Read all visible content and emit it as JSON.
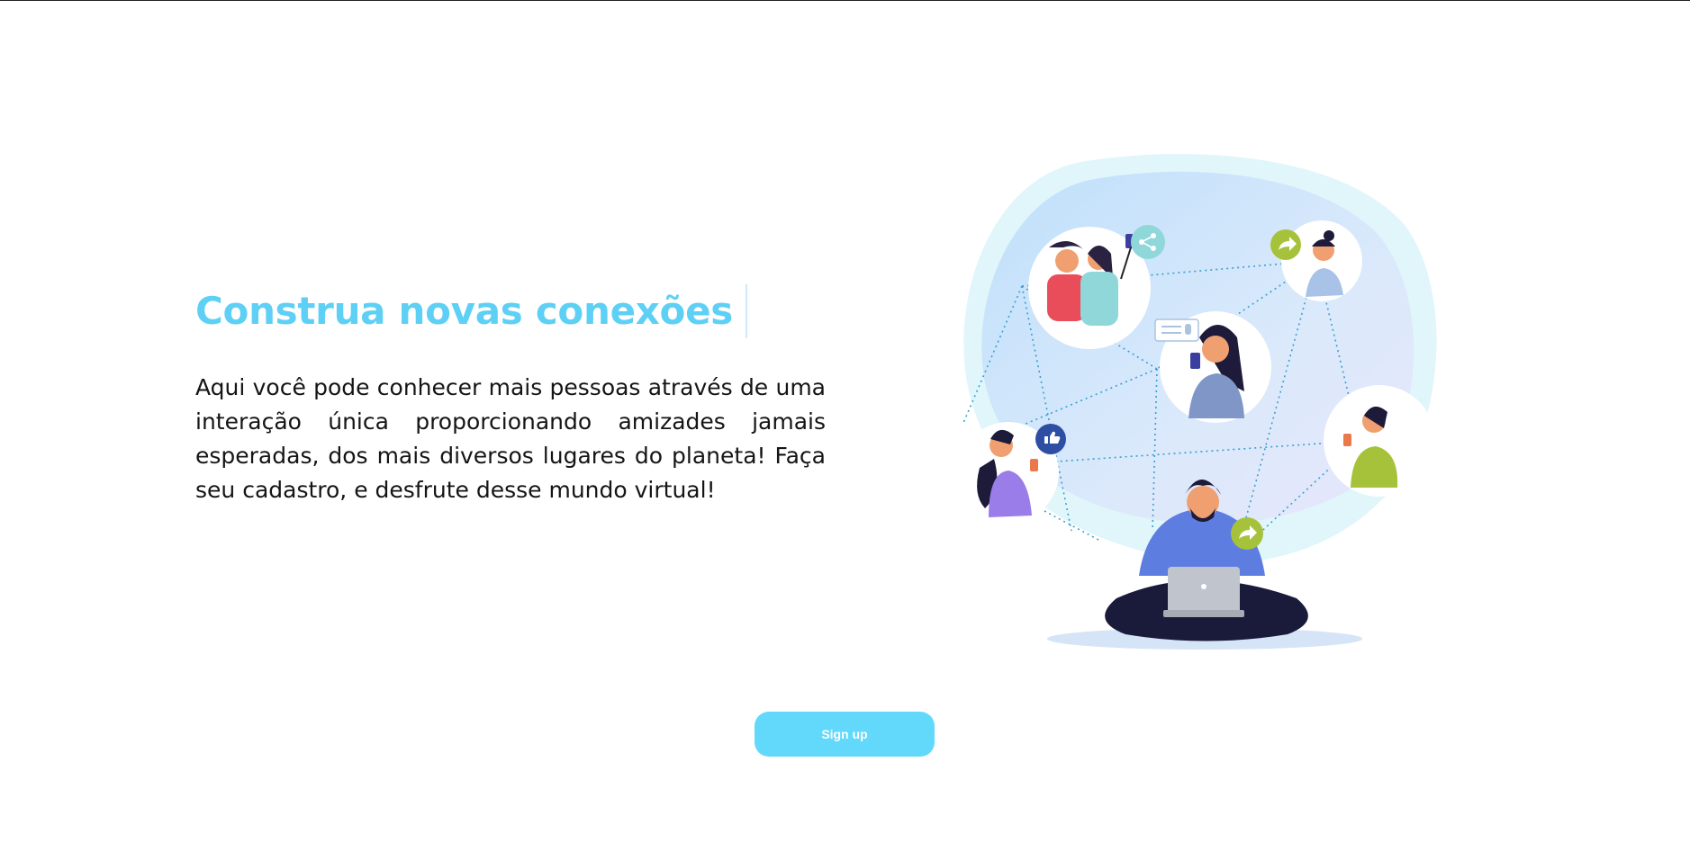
{
  "hero": {
    "title": "Construa novas conexões",
    "description": "Aqui você pode conhecer mais pessoas através de uma interação única proporcionando amizades jamais esperadas, dos mais diversos lugares do planeta! Faça seu cadastro, e desfrute desse mundo virtual!"
  },
  "cta": {
    "signup_label": "Sign up"
  },
  "colors": {
    "accent": "#5ed0f5",
    "button": "#62d9fb",
    "text": "#151515"
  },
  "illustration": {
    "icons": [
      "share-icon",
      "forward-icon",
      "like-icon",
      "message-icon",
      "forward-icon"
    ]
  }
}
